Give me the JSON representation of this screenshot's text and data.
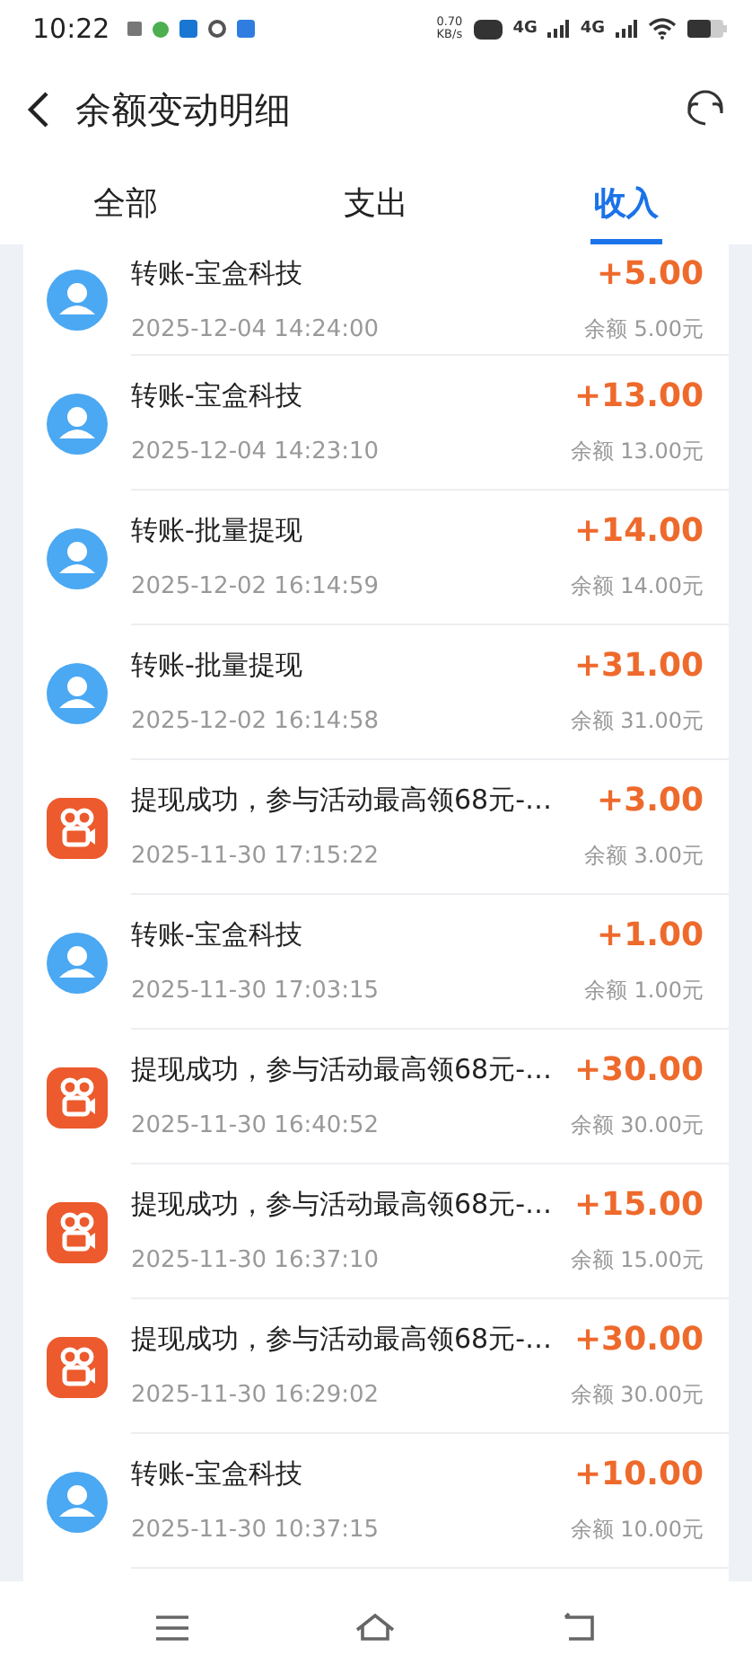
{
  "status_bar": {
    "time": "10:22",
    "speed": "0.70",
    "speed_unit": "KB/s",
    "network_1": "4G",
    "network_2": "4G"
  },
  "header": {
    "title": "余额变动明细"
  },
  "tabs": [
    {
      "label": "全部",
      "selected": false
    },
    {
      "label": "支出",
      "selected": false
    },
    {
      "label": "收入",
      "selected": true
    }
  ],
  "transactions": [
    {
      "kind": "transfer",
      "title": "转账-宝盒科技",
      "time": "2025-12-04 14:24:00",
      "amount": "+5.00",
      "balance": "余额 5.00元"
    },
    {
      "kind": "transfer",
      "title": "转账-宝盒科技",
      "time": "2025-12-04 14:23:10",
      "amount": "+13.00",
      "balance": "余额 13.00元"
    },
    {
      "kind": "transfer",
      "title": "转账-批量提现",
      "time": "2025-12-02 16:14:59",
      "amount": "+14.00",
      "balance": "余额 14.00元"
    },
    {
      "kind": "transfer",
      "title": "转账-批量提现",
      "time": "2025-12-02 16:14:58",
      "amount": "+31.00",
      "balance": "余额 31.00元"
    },
    {
      "kind": "app",
      "title": "提现成功，参与活动最高领68元-…",
      "time": "2025-11-30 17:15:22",
      "amount": "+3.00",
      "balance": "余额 3.00元"
    },
    {
      "kind": "transfer",
      "title": "转账-宝盒科技",
      "time": "2025-11-30 17:03:15",
      "amount": "+1.00",
      "balance": "余额 1.00元"
    },
    {
      "kind": "app",
      "title": "提现成功，参与活动最高领68元-…",
      "time": "2025-11-30 16:40:52",
      "amount": "+30.00",
      "balance": "余额 30.00元"
    },
    {
      "kind": "app",
      "title": "提现成功，参与活动最高领68元-…",
      "time": "2025-11-30 16:37:10",
      "amount": "+15.00",
      "balance": "余额 15.00元"
    },
    {
      "kind": "app",
      "title": "提现成功，参与活动最高领68元-…",
      "time": "2025-11-30 16:29:02",
      "amount": "+30.00",
      "balance": "余额 30.00元"
    },
    {
      "kind": "transfer",
      "title": "转账-宝盒科技",
      "time": "2025-11-30 10:37:15",
      "amount": "+10.00",
      "balance": "余额 10.00元"
    }
  ]
}
